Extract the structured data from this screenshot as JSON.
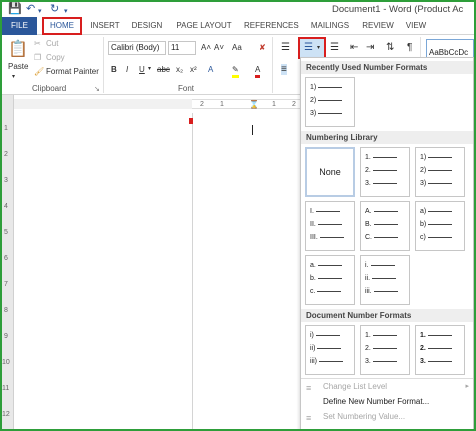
{
  "title_bar": {
    "text": "Document1 - Word (Product Ac",
    "save_icon": "save-icon",
    "undo_icon": "undo-icon",
    "redo_icon": "redo-icon"
  },
  "tabs": [
    "FILE",
    "HOME",
    "INSERT",
    "DESIGN",
    "PAGE LAYOUT",
    "REFERENCES",
    "MAILINGS",
    "REVIEW",
    "VIEW"
  ],
  "clipboard": {
    "paste": "Paste",
    "cut": "Cut",
    "copy": "Copy",
    "format_painter": "Format Painter",
    "group_label": "Clipboard"
  },
  "font": {
    "font_name": "Calibri (Body)",
    "font_size": "11",
    "grow": "A˄",
    "shrink": "A˅",
    "case": "Aa",
    "bold": "B",
    "italic": "I",
    "underline": "U",
    "strike": "abc",
    "subscript": "x₂",
    "superscript": "x²",
    "group_label": "Font"
  },
  "paragraph": {
    "pilcrow": "¶"
  },
  "styles": {
    "tile_label": "AaBbCcDc"
  },
  "ruler": {
    "h_numbers": [
      "2",
      "1",
      "1",
      "2"
    ],
    "v_numbers": [
      "1",
      "2",
      "3",
      "4",
      "5",
      "6",
      "7",
      "8",
      "9",
      "10",
      "11",
      "12"
    ]
  },
  "numbering_panel": {
    "recent_header": "Recently Used Number Formats",
    "recent_items": [
      "1)",
      "2)",
      "3)"
    ],
    "library_header": "Numbering Library",
    "none_label": "None",
    "library": [
      [
        "1.",
        "2.",
        "3."
      ],
      [
        "1)",
        "2)",
        "3)"
      ],
      [
        "I.",
        "II.",
        "III."
      ],
      [
        "A.",
        "B.",
        "C."
      ],
      [
        "a)",
        "b)",
        "c)"
      ],
      [
        "a.",
        "b.",
        "c."
      ],
      [
        "i.",
        "ii.",
        "iii."
      ]
    ],
    "document_header": "Document Number Formats",
    "document": [
      [
        "i)",
        "ii)",
        "iii)"
      ],
      [
        "1.",
        "2.",
        "3."
      ],
      [
        "1.",
        "2.",
        "3."
      ]
    ],
    "change_list_level": "Change List Level",
    "define_new": "Define New Number Format...",
    "set_value": "Set Numbering Value..."
  },
  "colors": {
    "accent": "#2b579a",
    "highlight_border": "#d81e1e",
    "frame": "#2e9e3a"
  }
}
